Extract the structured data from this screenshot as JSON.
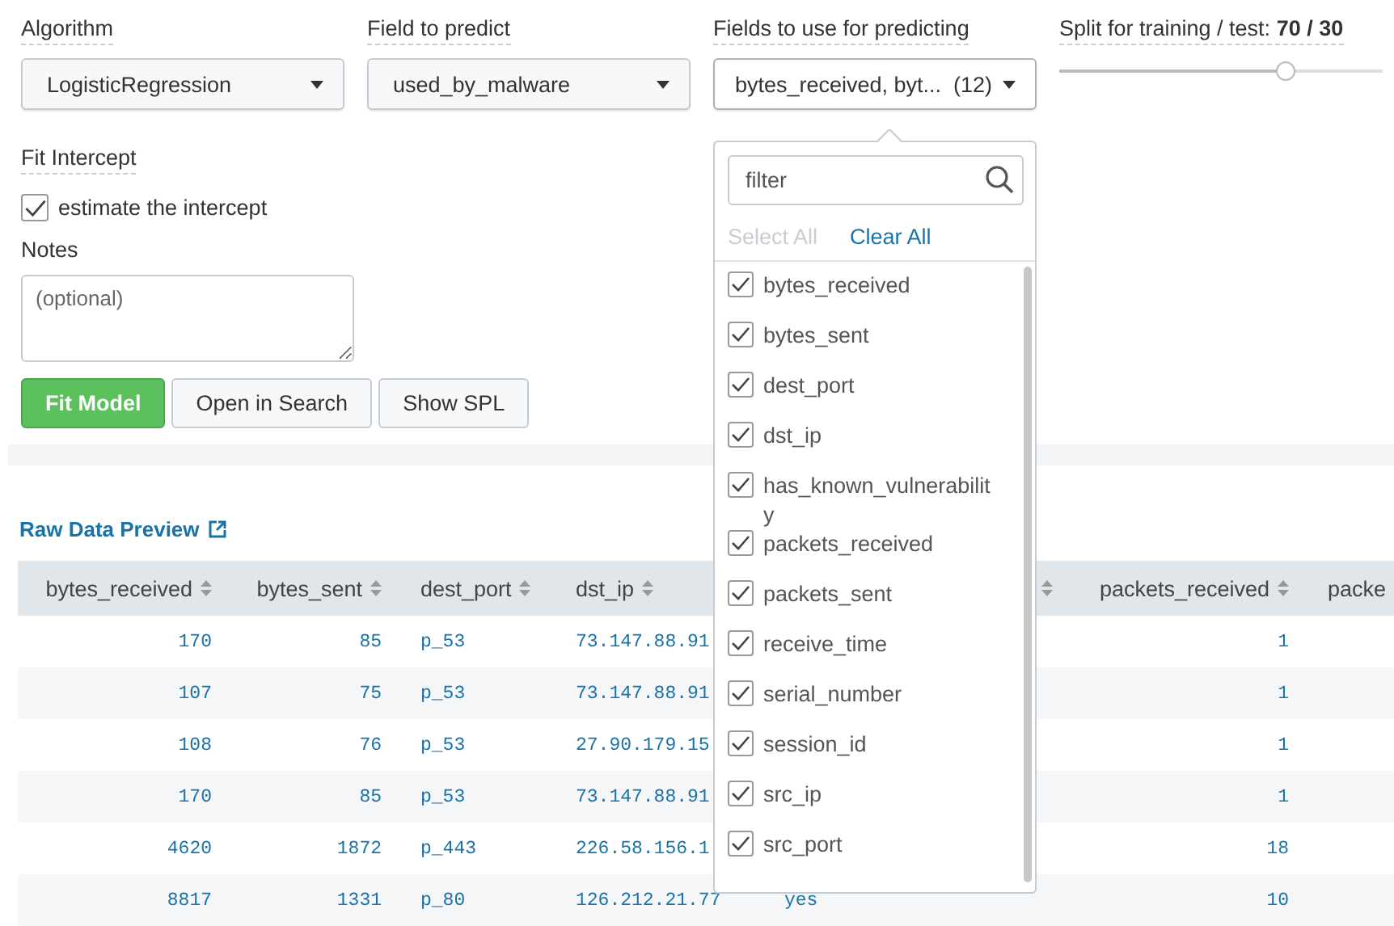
{
  "form": {
    "algorithm": {
      "label": "Algorithm",
      "value": "LogisticRegression"
    },
    "field_to_predict": {
      "label": "Field to predict",
      "value": "used_by_malware"
    },
    "fields_to_use": {
      "label": "Fields to use for predicting",
      "value": "bytes_received, byt...",
      "count": "(12)",
      "expanded": true
    },
    "split": {
      "label": "Split for training / test: ",
      "value": "70 / 30",
      "level": 0.7
    },
    "fit_intercept": {
      "label": "Fit Intercept",
      "option": "estimate the intercept",
      "checked": true
    },
    "notes": {
      "label": "Notes",
      "placeholder": "(optional)"
    },
    "buttons": [
      {
        "label": "Fit Model",
        "kind": "primary"
      },
      {
        "label": "Open in Search",
        "kind": "default"
      },
      {
        "label": "Show SPL",
        "kind": "default"
      }
    ]
  },
  "dropdown": {
    "filter_placeholder": "filter",
    "select_all": {
      "label": "Select All",
      "disabled": true
    },
    "clear_all": {
      "label": "Clear All",
      "disabled": false
    },
    "items": [
      {
        "label": "bytes_received",
        "checked": true
      },
      {
        "label": "bytes_sent",
        "checked": true
      },
      {
        "label": "dest_port",
        "checked": true
      },
      {
        "label": "dst_ip",
        "checked": true
      },
      {
        "label": "has_known_vulnerabilit y",
        "checked": true
      },
      {
        "label": "packets_received",
        "checked": true
      },
      {
        "label": "packets_sent",
        "checked": true
      },
      {
        "label": "receive_time",
        "checked": true
      },
      {
        "label": "serial_number",
        "checked": true
      },
      {
        "label": "session_id",
        "checked": true
      },
      {
        "label": "src_ip",
        "checked": true
      },
      {
        "label": "src_port",
        "checked": true
      }
    ]
  },
  "preview": {
    "title": "Raw Data Preview",
    "table": {
      "columns": [
        {
          "label": "bytes_received",
          "kind": "numeric"
        },
        {
          "label": "bytes_sent",
          "kind": "numeric"
        },
        {
          "label": "dest_port",
          "kind": "text"
        },
        {
          "label": "dst_ip",
          "kind": "text"
        },
        {
          "kind": "text"
        },
        {
          "label": "packets_received",
          "kind": "numeric"
        },
        {
          "label": "packe",
          "kind": "text"
        }
      ],
      "rows": [
        [
          "170",
          "85",
          "p_53",
          "73.147.88.91",
          "",
          "1",
          ""
        ],
        [
          "107",
          "75",
          "p_53",
          "73.147.88.91",
          "",
          "1",
          ""
        ],
        [
          "108",
          "76",
          "p_53",
          "27.90.179.15",
          "",
          "1",
          ""
        ],
        [
          "170",
          "85",
          "p_53",
          "73.147.88.91",
          "",
          "1",
          ""
        ],
        [
          "4620",
          "1872",
          "p_443",
          "226.58.156.1",
          "",
          "18",
          ""
        ],
        [
          "8817",
          "1331",
          "p_80",
          "126.212.21.77",
          "yes",
          "10",
          ""
        ]
      ]
    }
  }
}
